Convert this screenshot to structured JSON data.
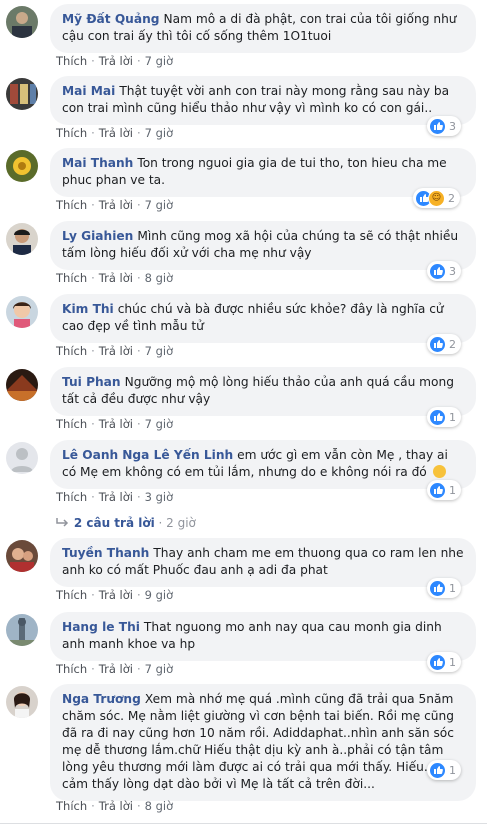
{
  "labels": {
    "like": "Thích",
    "reply": "Trả lời"
  },
  "comments": [
    {
      "name": "Mỹ Đất Quảng",
      "text": "Nam mô a di đà phật, con trai của tôi giống như cậu con trai ấy thì tôi cố sống thêm 1O1tuoi",
      "time": "7 giờ",
      "reactions": null
    },
    {
      "name": "Mai Mai",
      "text": "Thật tuyệt vời anh con trai này mong rằng sau này ba con trai mình cũng hiểu thảo như vậy vì mình ko có con gái..",
      "time": "7 giờ",
      "reactions": {
        "count": "3",
        "icons": [
          "like"
        ]
      }
    },
    {
      "name": "Mai Thanh",
      "text": "Ton trong nguoi gia gia de tui tho, ton hieu cha me phuc phan ve ta.",
      "time": "7 giờ",
      "reactions": {
        "count": "2",
        "icons": [
          "like",
          "haha"
        ]
      }
    },
    {
      "name": "Ly Giahien",
      "text": "Mình cũng mog xã hội của chúng ta sẽ có thật nhiều tấm lòng hiếu đối xử với cha mẹ như vậy",
      "time": "8 giờ",
      "reactions": {
        "count": "3",
        "icons": [
          "like"
        ]
      }
    },
    {
      "name": "Kim Thi",
      "text": "chúc chú và bà được nhiều sức khỏe? đây là nghĩa cử cao đẹp về tình mẫu tử",
      "time": "7 giờ",
      "reactions": {
        "count": "2",
        "icons": [
          "like"
        ]
      }
    },
    {
      "name": "Tui Phan",
      "text": "Ngưỡng mộ mộ lòng hiếu thảo của anh quá cầu mong tất cả đều được như vậy",
      "time": "7 giờ",
      "reactions": {
        "count": "1",
        "icons": [
          "like"
        ]
      }
    },
    {
      "name": "Lê Oanh",
      "tag": "Nga Lê Yến Linh",
      "text": "em ước gì em vẫn còn Mẹ , thay ai có Mẹ em không có em tủi lắm, nhưng do e không nói ra đó",
      "time": "3 giờ",
      "reactions": {
        "count": "1",
        "icons": [
          "like"
        ]
      }
    },
    {
      "name": "Tuyền Thanh",
      "text": "Thay anh cham me em thuong qua co ram len nhe anh ko có mất Phuốc đau anh ạ adi đa phat",
      "time": "9 giờ",
      "reactions": {
        "count": "1",
        "icons": [
          "like"
        ]
      }
    },
    {
      "name": "Hang le Thi",
      "text": "That nguong mo anh nay qua cau monh gia dinh anh manh khoe va hp",
      "time": "7 giờ",
      "reactions": {
        "count": "1",
        "icons": [
          "like"
        ]
      }
    },
    {
      "name": "Nga Trương",
      "text": "Xem mà nhớ mẹ quá .mình cũng đã trải qua 5năm chăm sóc. Mẹ nằm liệt giường vì cơn bệnh tai biến. Rồi mẹ cũng đã ra đi nay cũng hơn 10 năm rồi. Adiddaphat..nhìn anh săn sóc mẹ dễ thương lắm.chữ Hiếu thật dịu kỳ anh à..phải có tận tâm lòng yêu thương mới làm được ai có trải qua mới thấy. Hiếu.. Sẽ cảm thấy lòng dạt dào bởi vì Mẹ là tất cả trên đời...",
      "time": "8 giờ",
      "reactions": {
        "count": "1",
        "icons": [
          "like"
        ]
      }
    }
  ],
  "replies_thread": {
    "label": "2 câu trả lời",
    "time": "2 giờ"
  },
  "icons": {
    "like": "thumbs-up-icon",
    "haha": "haha-icon",
    "reply_arrow": "reply-arrow-icon"
  },
  "colors": {
    "name": "#385898",
    "bubble": "#f2f3f5",
    "like": "#2d88ff"
  }
}
